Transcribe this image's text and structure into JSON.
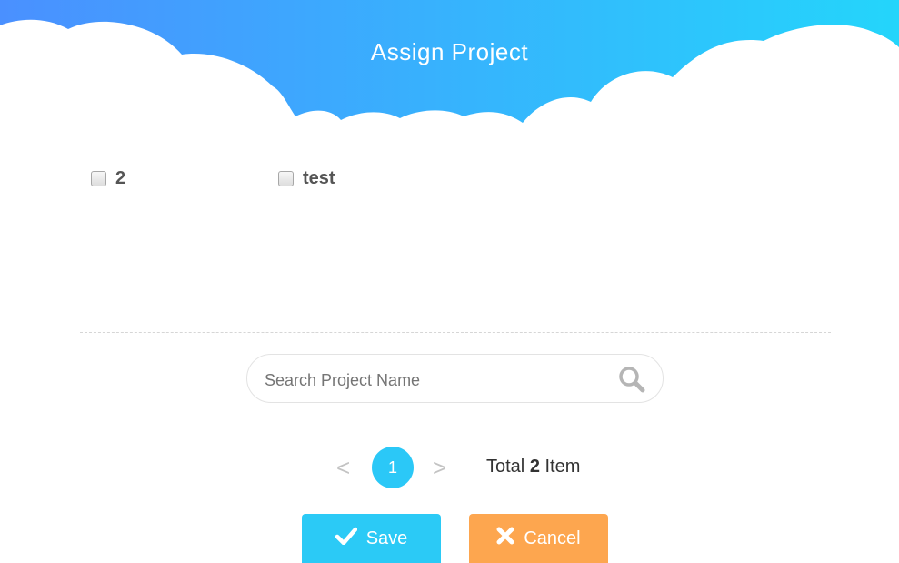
{
  "dialog": {
    "title": "Assign Project",
    "header_gradient": [
      "#4a90ff",
      "#24d5fb"
    ]
  },
  "projects": [
    {
      "label": "2",
      "checked": false
    },
    {
      "label": "test",
      "checked": false
    }
  ],
  "search": {
    "placeholder": "Search Project Name",
    "value": "",
    "icon": "search-icon"
  },
  "pagination": {
    "prev_label": "<",
    "current_page": "1",
    "next_label": ">",
    "total_prefix": "Total",
    "total_count": "2",
    "total_suffix": "Item",
    "active_color": "#2bc8f7"
  },
  "buttons": {
    "save_label": "Save",
    "save_icon": "check-icon",
    "save_color": "#2bcaf6",
    "cancel_label": "Cancel",
    "cancel_icon": "x-icon",
    "cancel_color": "#fda64f"
  }
}
